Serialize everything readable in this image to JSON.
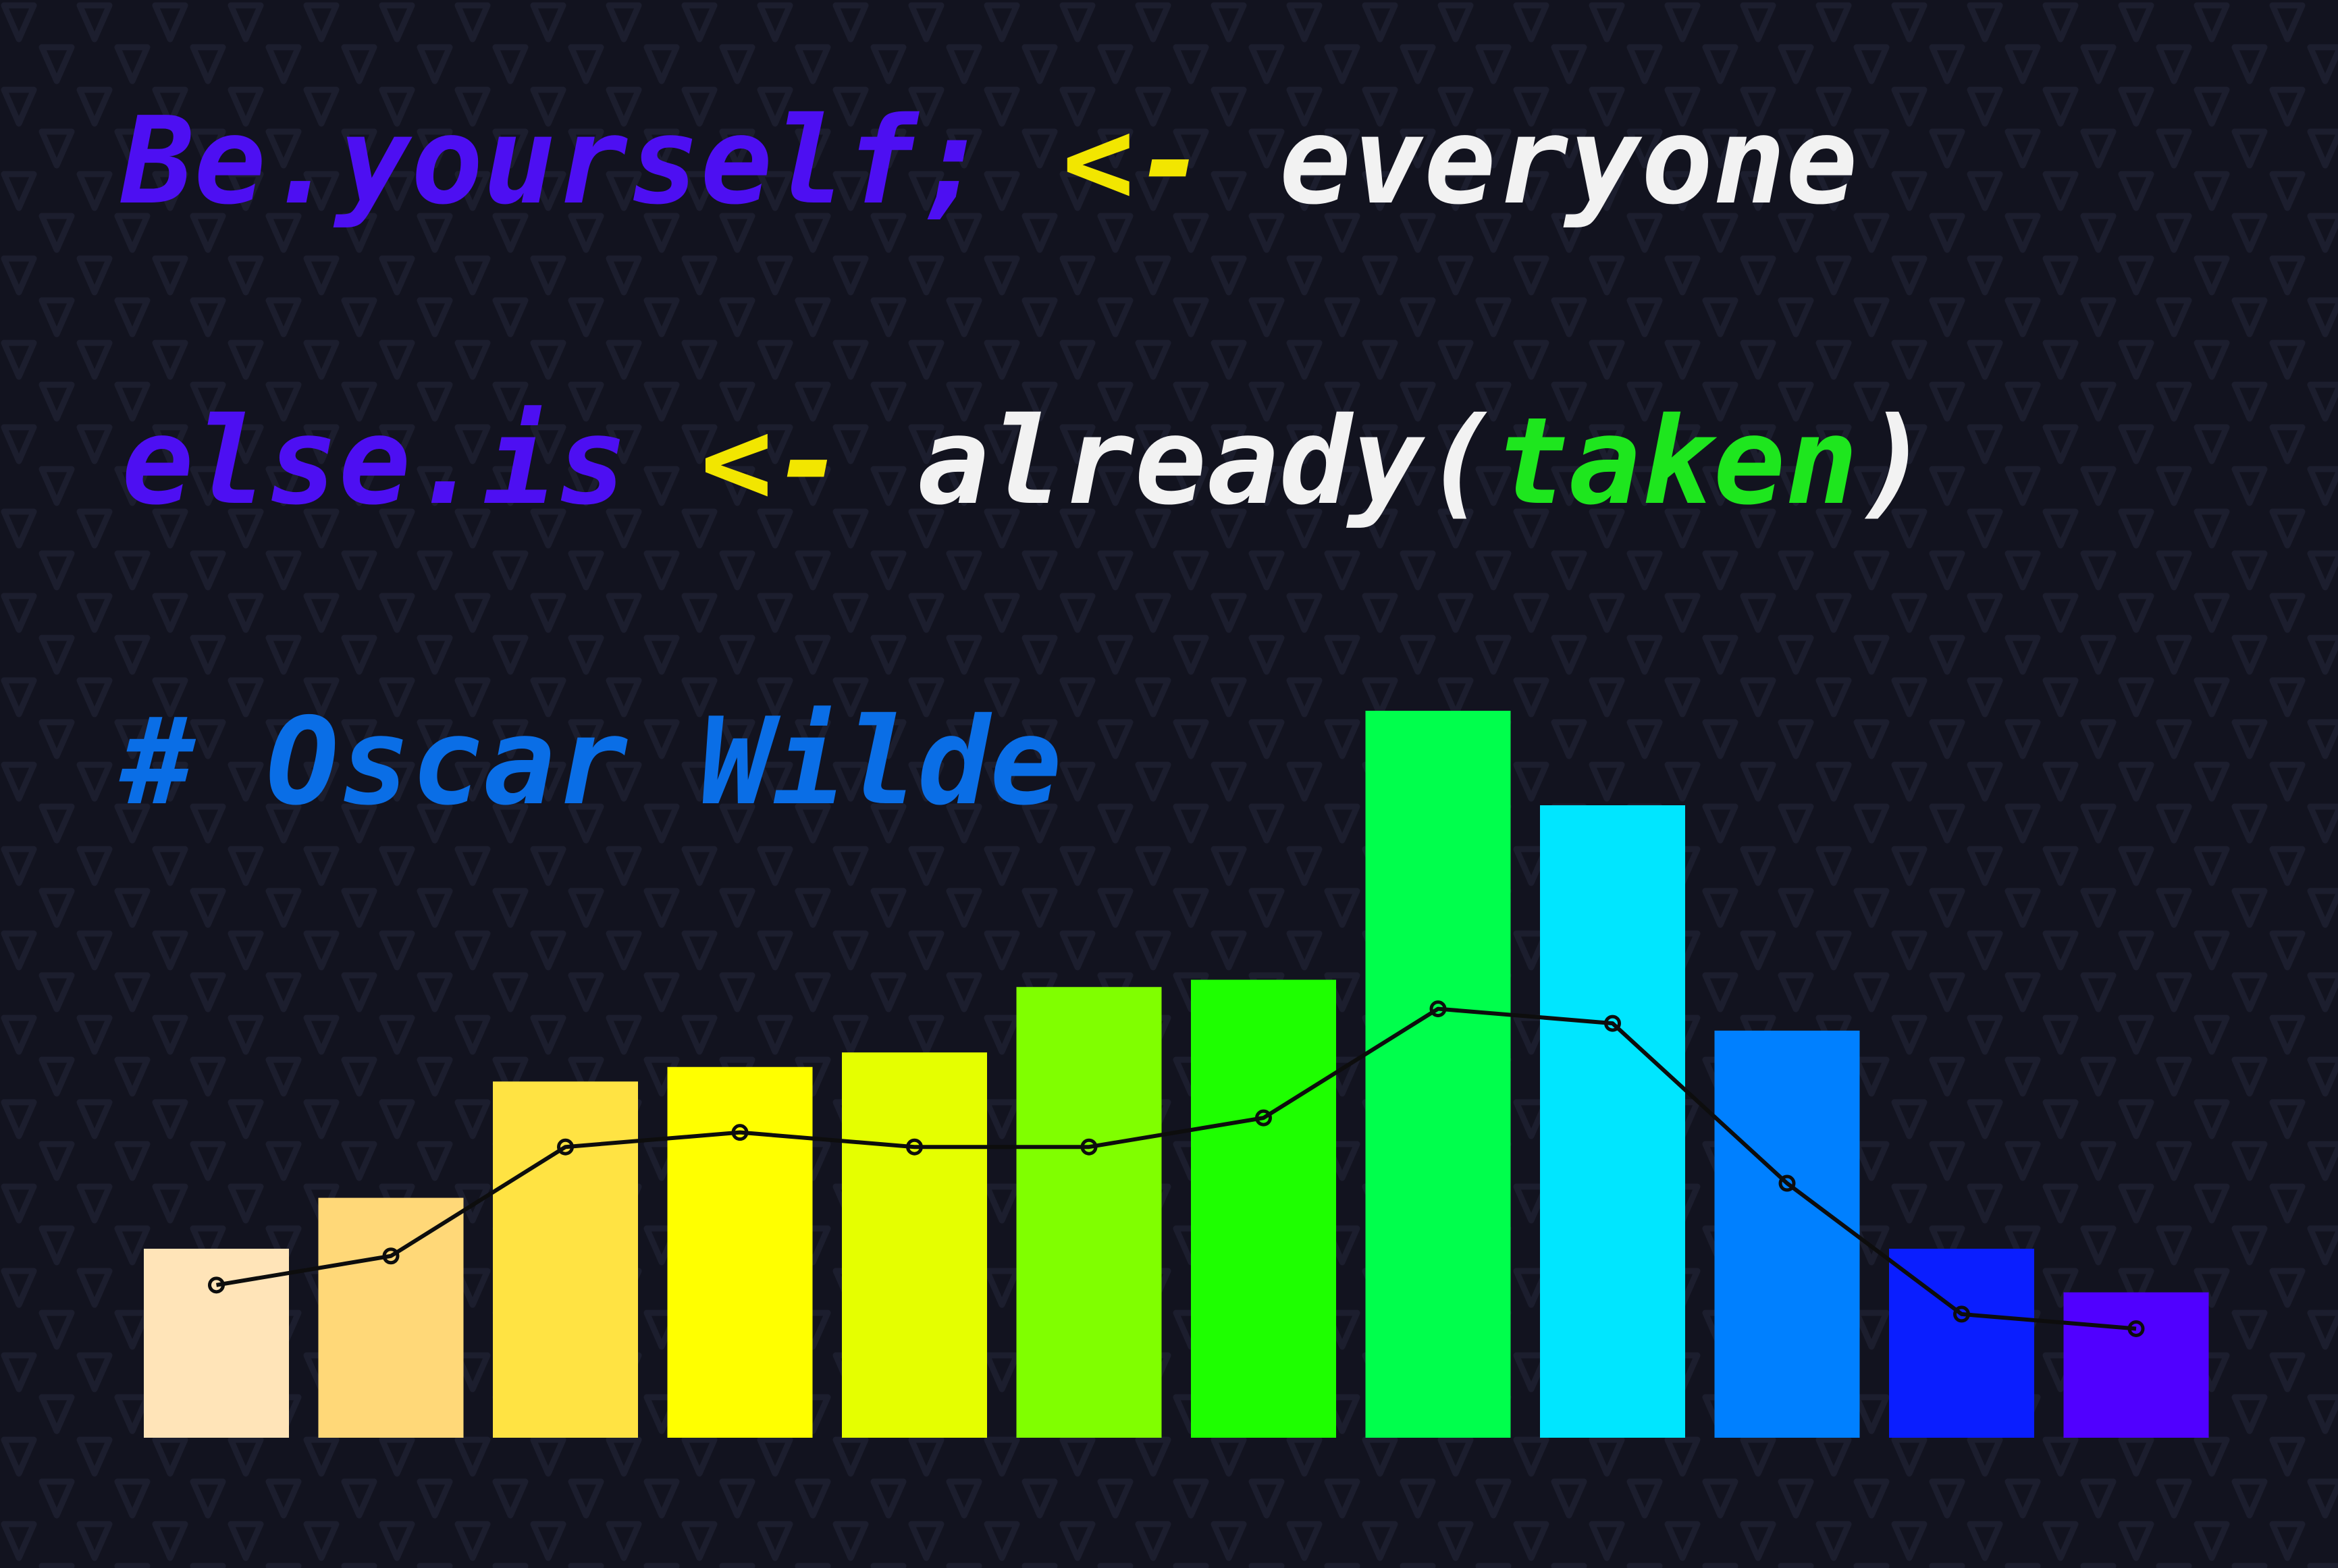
{
  "colors": {
    "background": "#12131f",
    "identifier": "#4d0ff2",
    "operator": "#f2e600",
    "string": "#f2f2f2",
    "argument": "#1ee61e",
    "comment": "#0a6ee6",
    "line": "#0d0d0d"
  },
  "quote": {
    "line1": {
      "part1": "Be.yourself;",
      "space1": " ",
      "part2": "<-",
      "space2": " ",
      "part3": "everyone"
    },
    "line2": {
      "part1": "else.is",
      "space1": " ",
      "part2": "<-",
      "space2": " ",
      "part3": "already(",
      "part4": "taken",
      "part5": ")"
    },
    "line3": {
      "part1": "# Oscar Wilde"
    }
  },
  "chart_data": {
    "type": "bar",
    "ylim": [
      0,
      100
    ],
    "grid": false,
    "legend": "none",
    "categories": [
      "",
      "",
      "",
      "",
      "",
      "",
      "",
      "",
      "",
      "",
      "",
      ""
    ],
    "series": [
      {
        "values": [
          26,
          33,
          49,
          51,
          53,
          62,
          63,
          100,
          87,
          56,
          26,
          20
        ],
        "colors": [
          "#ffe4b8",
          "#ffd878",
          "#ffe343",
          "#ffff00",
          "#e5ff00",
          "#80ff00",
          "#1eff00",
          "#00ff4c",
          "#00e6ff",
          "#0080ff",
          "#0a1eff",
          "#5000ff"
        ]
      },
      {
        "type": "line",
        "values": [
          21,
          25,
          40,
          42,
          40,
          40,
          44,
          59,
          57,
          35,
          17,
          15
        ],
        "color": "#0d0d0d"
      }
    ]
  }
}
